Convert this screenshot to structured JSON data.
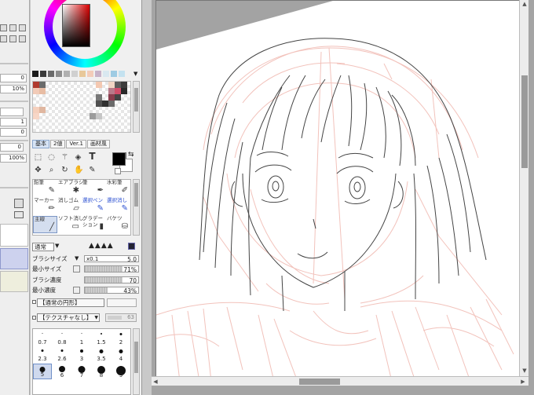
{
  "left_panel": {
    "values": [
      "0",
      "10%",
      "1",
      "0",
      "0",
      "100%"
    ]
  },
  "palette": {
    "top_row_colors": [
      "#1a1a1a",
      "#3a3a3a",
      "#6b6b6b",
      "#8e8e8e",
      "#b0b0b0",
      "#d0d0d0",
      "#e8c89a",
      "#f3ccb9",
      "#c7b2c8",
      "#d9e8f0",
      "#9ecbe3",
      "#c4e2f0"
    ],
    "swatches": [
      {
        "c": "#b03a2e"
      },
      {
        "c": "#6b6b6b"
      },
      {
        "c": "#f4c8b1"
      },
      {
        "c": "#f0d4c4"
      },
      {
        "c": "#5c5c5c"
      },
      {
        "c": "#3c3c3c"
      },
      {
        "c": "#f2cbb8"
      },
      {
        "c": "#e8bda4"
      },
      {
        "c": "#b87a8a"
      },
      {
        "c": "#d14e6a"
      },
      {
        "c": "#2a2a2a"
      },
      {
        "c": "#777777"
      },
      {
        "c": "#8a3e4e"
      },
      {
        "c": "#444444"
      },
      {
        "c": "#f5d0bd"
      },
      {
        "c": "#e0b7a0"
      },
      {
        "c": "#505050"
      },
      {
        "c": "#303030"
      },
      {
        "c": "#6a6a6a"
      },
      {
        "c": "#f7d6c6"
      },
      {
        "c": "#9c9c9c"
      },
      {
        "c": "#c6c6c6"
      }
    ]
  },
  "tabs": [
    "基本",
    "2値",
    "Ver.1",
    "画材風"
  ],
  "tool_icons": [
    "rect-select-icon",
    "lasso-icon",
    "magic-wand-icon",
    "bucket-select-icon",
    "text-tool-icon",
    "move-icon",
    "zoom-icon",
    "rotate-icon",
    "hand-icon",
    "eyedropper-icon"
  ],
  "brushes": [
    {
      "label": "鉛筆",
      "icon": "pencil-icon",
      "selected": false,
      "blue": false
    },
    {
      "label": "エアブラシ",
      "icon": "airbrush-icon",
      "selected": false,
      "blue": false
    },
    {
      "label": "筆",
      "icon": "brush-icon",
      "selected": false,
      "blue": false
    },
    {
      "label": "水彩筆",
      "icon": "watercolor-icon",
      "selected": false,
      "blue": false
    },
    {
      "label": "マーカー",
      "icon": "marker-icon",
      "selected": false,
      "blue": false
    },
    {
      "label": "消しゴム",
      "icon": "eraser-icon",
      "selected": false,
      "blue": false
    },
    {
      "label": "選択ペン",
      "icon": "select-pen-icon",
      "selected": false,
      "blue": true
    },
    {
      "label": "選択消し",
      "icon": "select-erase-icon",
      "selected": false,
      "blue": true
    },
    {
      "label": "主線",
      "icon": "line-brush-icon",
      "selected": true,
      "blue": false
    },
    {
      "label": "ソフト消し",
      "icon": "soft-eraser-icon",
      "selected": false,
      "blue": false
    },
    {
      "label": "グラデー\nション",
      "icon": "gradient-icon",
      "selected": false,
      "blue": false
    },
    {
      "label": "バケツ",
      "icon": "bucket-icon",
      "selected": false,
      "blue": false
    }
  ],
  "brush_settings": {
    "blend_mode": "通常",
    "brush_size_label": "ブラシサイズ",
    "brush_size_multiplier": "x0.1",
    "brush_size_value": "5.0",
    "min_size_label": "最小サイズ",
    "min_size_value": "71%",
    "min_size_fill": 0.71,
    "density_label": "ブラシ濃度",
    "density_value": "70",
    "density_fill": 0.7,
    "min_density_label": "最小濃度",
    "min_density_value": "43%",
    "min_density_fill": 0.43,
    "shape_dropdown": "【通常の円形】",
    "texture_dropdown": "【テクスチャなし】",
    "texture_strength": "63"
  },
  "dot_sizes": [
    {
      "label": "0.7"
    },
    {
      "label": "0.8"
    },
    {
      "label": "1"
    },
    {
      "label": "1.5"
    },
    {
      "label": "2"
    },
    {
      "label": "2.3"
    },
    {
      "label": "2.6"
    },
    {
      "label": "3"
    },
    {
      "label": "3.5"
    },
    {
      "label": "4"
    },
    {
      "label": "5",
      "selected": true
    },
    {
      "label": "6"
    },
    {
      "label": "7"
    },
    {
      "label": "8"
    },
    {
      "label": "9"
    }
  ],
  "canvas": {
    "sketch_color": "#f0b8b0",
    "line_color": "#444444"
  }
}
